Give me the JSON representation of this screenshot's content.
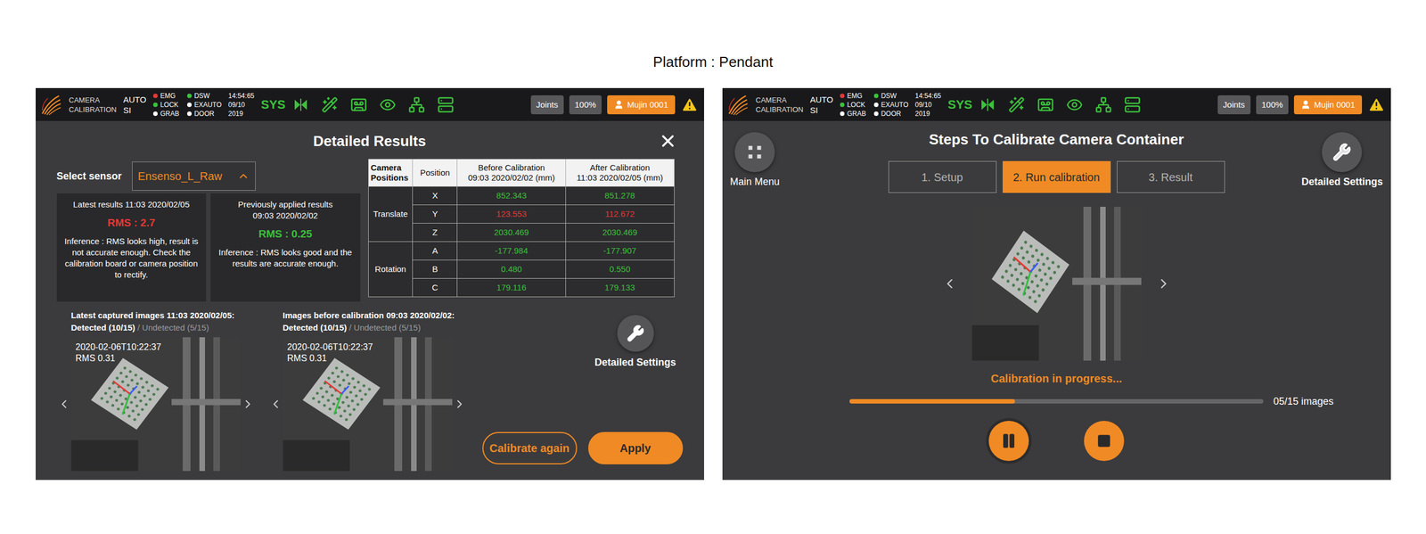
{
  "page_title": "Platform : Pendant",
  "results_screen": {
    "top_bar": {
      "app_name_lines": [
        "CAMERA",
        "CALIBRATION"
      ],
      "mode_lines": [
        "AUTO",
        "SI"
      ],
      "statuses": [
        {
          "label": "EMG",
          "color": "#e53935"
        },
        {
          "label": "LOCK",
          "color": "#3cc13c"
        },
        {
          "label": "GRAB",
          "color": "#ffffff"
        },
        {
          "label": "DSW",
          "color": "#3cc13c"
        },
        {
          "label": "EXAUTO",
          "color": "#ffffff"
        },
        {
          "label": "DOOR",
          "color": "#ffffff"
        }
      ],
      "time_lines": [
        "14:54:65",
        "09/10",
        "2019"
      ],
      "sys": "SYS",
      "joints": "Joints",
      "speed": "100%",
      "user": "Mujin 0001"
    },
    "title": "Detailed Results",
    "sensor": {
      "label": "Select sensor",
      "value": "Ensenso_L_Raw"
    },
    "result_cards": [
      {
        "title_lines": [
          "Latest results 11:03 2020/02/05"
        ],
        "rms": "RMS : 2.7",
        "color": "#e53935",
        "inference": "Inference : RMS looks high, result is not accurate enough. Check the calibration board or camera position to rectify."
      },
      {
        "title_lines": [
          "Previously applied results",
          "09:03 2020/02/02"
        ],
        "rms": "RMS : 0.25",
        "color": "#3cc13c",
        "inference": "Inference : RMS looks good and the results are accurate enough."
      }
    ],
    "table": {
      "columns": [
        [
          "Camera",
          "Positions"
        ],
        [
          "Position"
        ],
        [
          "Before Calibration",
          "09:03 2020/02/02 (mm)"
        ],
        [
          "After Calibration",
          "11:03 2020/02/05 (mm)"
        ]
      ],
      "groups": [
        {
          "name": "Translate",
          "rows": [
            {
              "axis": "X",
              "before": "852.343",
              "before_color": "#3cc13c",
              "after": "851.278",
              "after_color": "#3cc13c"
            },
            {
              "axis": "Y",
              "before": "123.553",
              "before_color": "#e53935",
              "after": "112.672",
              "after_color": "#e53935"
            },
            {
              "axis": "Z",
              "before": "2030.469",
              "before_color": "#3cc13c",
              "after": "2030.469",
              "after_color": "#3cc13c"
            }
          ]
        },
        {
          "name": "Rotation",
          "rows": [
            {
              "axis": "A",
              "before": "-177.984",
              "before_color": "#3cc13c",
              "after": "-177.907",
              "after_color": "#3cc13c"
            },
            {
              "axis": "B",
              "before": "0.480",
              "before_color": "#3cc13c",
              "after": "0.550",
              "after_color": "#3cc13c"
            },
            {
              "axis": "C",
              "before": "179.116",
              "before_color": "#3cc13c",
              "after": "179.133",
              "after_color": "#3cc13c"
            }
          ]
        }
      ]
    },
    "galleries": [
      {
        "title": "Latest captured images 11:03 2020/02/05:",
        "detected": "Detected (10/15)",
        "undetected": "/ Undetected (5/15)",
        "image_lines": [
          "2020-02-06T10:22:37",
          "RMS 0.31"
        ]
      },
      {
        "title": "Images before calibration 09:03 2020/02/02:",
        "detected": "Detected (10/15)",
        "undetected": "/ Undetected (5/15)",
        "image_lines": [
          "2020-02-06T10:22:37",
          "RMS 0.31"
        ]
      }
    ],
    "detailed_settings": "Detailed Settings",
    "buttons": [
      {
        "label": "Calibrate again",
        "kind": "outline"
      },
      {
        "label": "Apply",
        "kind": "filled"
      }
    ]
  },
  "calibration_screen": {
    "top_bar": {
      "app_name_lines": [
        "CAMERA",
        "CALIBRATION"
      ],
      "mode_lines": [
        "AUTO",
        "SI"
      ],
      "statuses": [
        {
          "label": "EMG",
          "color": "#e53935"
        },
        {
          "label": "LOCK",
          "color": "#3cc13c"
        },
        {
          "label": "GRAB",
          "color": "#ffffff"
        },
        {
          "label": "DSW",
          "color": "#3cc13c"
        },
        {
          "label": "EXAUTO",
          "color": "#ffffff"
        },
        {
          "label": "DOOR",
          "color": "#ffffff"
        }
      ],
      "time_lines": [
        "14:54:65",
        "09/10",
        "2019"
      ],
      "sys": "SYS",
      "joints": "Joints",
      "speed": "100%",
      "user": "Mujin 0001"
    },
    "main_menu": "Main Menu",
    "title": "Steps To Calibrate Camera Container",
    "steps": [
      {
        "label": "1. Setup",
        "selected": false
      },
      {
        "label": "2. Run calibration",
        "selected": true
      },
      {
        "label": "3. Result",
        "selected": false
      }
    ],
    "detailed_settings": "Detailed Settings",
    "status": "Calibration in progress...",
    "progress": {
      "level": 0.4,
      "reading": "05/15 images"
    }
  }
}
